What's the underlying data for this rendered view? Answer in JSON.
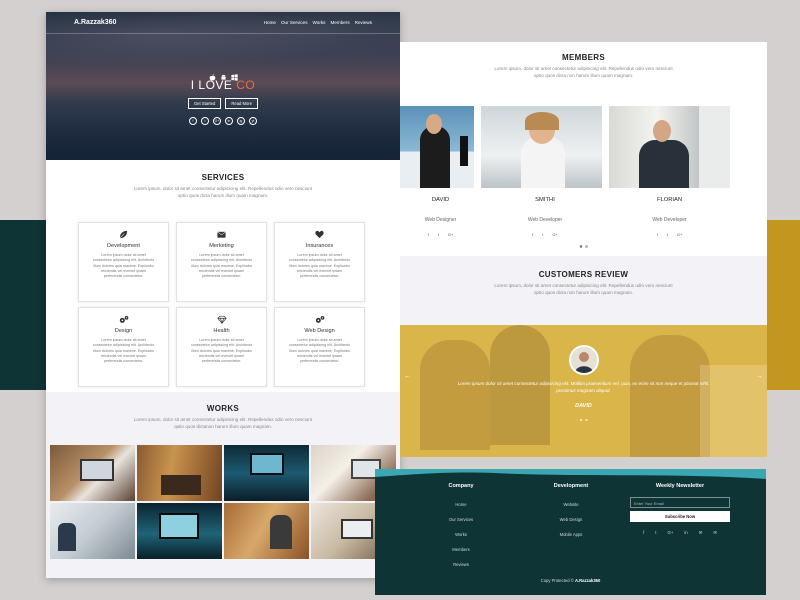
{
  "hero": {
    "brand": "A.Razzak360",
    "nav": [
      "Home",
      "Our Services",
      "Works",
      "Members",
      "Reviews"
    ],
    "title_main": "I LOVE ",
    "title_accent": "CO",
    "buttons": [
      "Get Started",
      "Read More"
    ],
    "social": [
      "f",
      "t",
      "G+",
      "in",
      "ig",
      "yt"
    ]
  },
  "services": {
    "title": "SERVICES",
    "description": "Lorem ipsum, dolor sit amet consectetur adipisicing elit. Repellendus odio vero nesciunt optio quos dicta harum illum quam magnam.",
    "cards": [
      {
        "title": "Development",
        "icon": "leaf-icon",
        "text": "Lorem ipsum dolor sit amet consectetur adipisicing elit. Architecto illum dolores quia maxime. Explicabo reiciendis vel eveniet ipsam perferendis consectetur."
      },
      {
        "title": "Merketing",
        "icon": "envelope-icon",
        "text": "Lorem ipsum dolor sit amet consectetur adipisicing elit. Architecto illum dolores quia maxime. Explicabo reiciendis vel eveniet ipsam perferendis consectetur."
      },
      {
        "title": "Insurances",
        "icon": "heart-icon",
        "text": "Lorem ipsum dolor sit amet consectetur adipisicing elit. Architecto illum dolores quia maxime. Explicabo reiciendis vel eveniet ipsam perferendis consectetur."
      },
      {
        "title": "Design",
        "icon": "gears-icon",
        "text": "Lorem ipsum dolor sit amet consectetur adipisicing elit. Architecto illum dolores quia maxime. Explicabo reiciendis vel eveniet ipsam perferendis consectetur."
      },
      {
        "title": "Health",
        "icon": "diamond-icon",
        "text": "Lorem ipsum dolor sit amet consectetur adipisicing elit. Architecto illum dolores quia maxime. Explicabo reiciendis vel eveniet ipsam perferendis consectetur."
      },
      {
        "title": "Web Design",
        "icon": "gears-icon",
        "text": "Lorem ipsum dolor sit amet consectetur adipisicing elit. Architecto illum dolores quia maxime. Explicabo reiciendis vel eveniet ipsam perferendis consectetur."
      }
    ]
  },
  "works": {
    "title": "WORKS",
    "description": "Lorem ipsum, dolor sit amet consectetur adipisicing elit. Repellendus odio vero nesciunt optio quos dictanon harum illum quam magnam."
  },
  "members": {
    "title": "MEMBERS",
    "description": "Lorem ipsum, dolor sit amet consectetur adipisicing elit. Repellendus odio vero nesciunt optio quos dicta non harum illum quam magnam.",
    "people": [
      {
        "name": "DAVID",
        "role": "Web Designer"
      },
      {
        "name": "SMITHI",
        "role": "Web Developer"
      },
      {
        "name": "FLORIAN",
        "role": "Web Developer"
      }
    ],
    "social": [
      "f",
      "t",
      "G+"
    ]
  },
  "reviews": {
    "title": "CUSTOMERS REVIEW",
    "description": "Lorem ipsum, dolor sit amet consectetur adipisicing elit. Repellendus odio vero nesciunt optio quos dicta non harum illum quam magnam.",
    "quote": "Lorem ipsum dolor sit amet consectetur adipisicing elit. Mollitia praesentium vel, quia, ex enim sit non neque et placeat nihil. possimus magnam aliquid.",
    "name": "DAVID",
    "arrow_left": "←",
    "arrow_right": "→"
  },
  "footer": {
    "company": {
      "heading": "Company",
      "links": [
        "Home",
        "Our Services",
        "Works",
        "Members",
        "Reviews"
      ]
    },
    "development": {
      "heading": "Development",
      "links": [
        "Website",
        "Web Design",
        "Mobile Apps"
      ]
    },
    "newsletter": {
      "heading": "Weekly Newsletter",
      "placeholder": "Enter Your Email",
      "button": "Subscribe Now",
      "social": [
        "f",
        "t",
        "G+",
        "in",
        "✉",
        "✉"
      ]
    },
    "copyright_prefix": "Copy Protected © ",
    "copyright_brand": "A.Razzak360"
  },
  "colors": {
    "accent": "#f06a3c",
    "dark_teal": "#0f3436",
    "mustard": "#c3971f",
    "review_yellow": "#dab54a"
  }
}
